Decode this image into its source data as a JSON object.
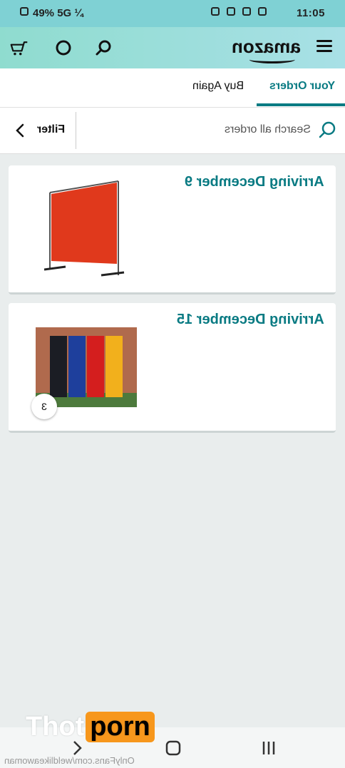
{
  "status": {
    "time": "11:05",
    "left": "49%  5G  ¼"
  },
  "header": {
    "logo": "amazon",
    "icons": [
      "menu-icon",
      "amazon-logo",
      "search-icon",
      "account-icon",
      "cart-icon"
    ]
  },
  "tabs": [
    {
      "label": "Your Orders",
      "active": true
    },
    {
      "label": "Buy Again",
      "active": false
    }
  ],
  "search": {
    "placeholder": "Search all orders",
    "filter_label": "Filter"
  },
  "orders": [
    {
      "title": "Arriving December 9",
      "image": "red-welding-curtain"
    },
    {
      "title": "Arriving December 15",
      "image": "multicolor-welding-curtains",
      "count": "3"
    }
  ],
  "watermark": {
    "brand_a": "Thot",
    "brand_b": "porn",
    "url": "OnlyFans.com/weldlikeawoman"
  },
  "colors": {
    "accent": "#0a7b83",
    "header_bg": "#8fdccf",
    "page_bg": "#e9eded"
  }
}
